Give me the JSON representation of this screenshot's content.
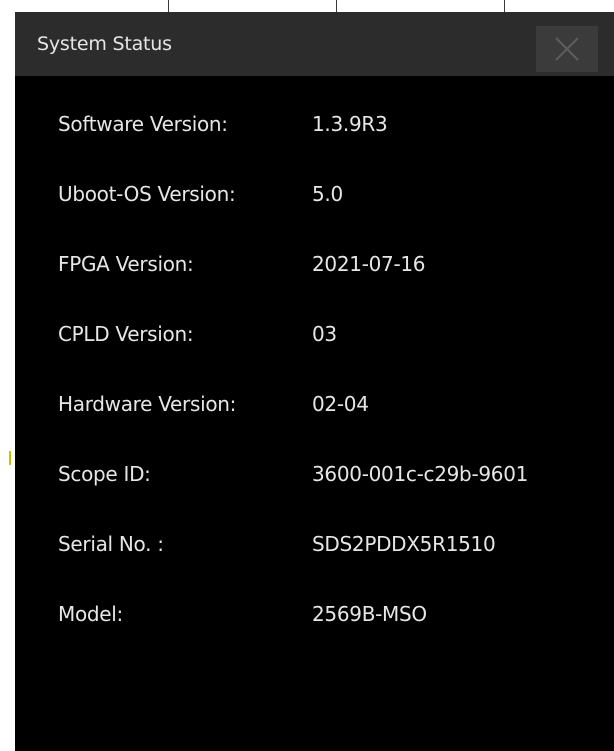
{
  "dialog": {
    "title": "System Status"
  },
  "rows": [
    {
      "label": "Software Version:",
      "value": "1.3.9R3"
    },
    {
      "label": "Uboot-OS Version:",
      "value": "5.0"
    },
    {
      "label": "FPGA Version:",
      "value": "2021-07-16"
    },
    {
      "label": "CPLD Version:",
      "value": "03"
    },
    {
      "label": "Hardware Version:",
      "value": "02-04"
    },
    {
      "label": "Scope ID:",
      "value": "3600-001c-c29b-9601"
    },
    {
      "label": "Serial No. :",
      "value": "SDS2PDDX5R1510"
    },
    {
      "label": "Model:",
      "value": "2569B-MSO"
    }
  ],
  "colors": {
    "dialog_bg": "#000000",
    "titlebar_bg": "#2c2c2c",
    "close_bg": "#3b3b3b",
    "text": "#e6e6e6"
  },
  "icons": {
    "close": "close-icon"
  }
}
